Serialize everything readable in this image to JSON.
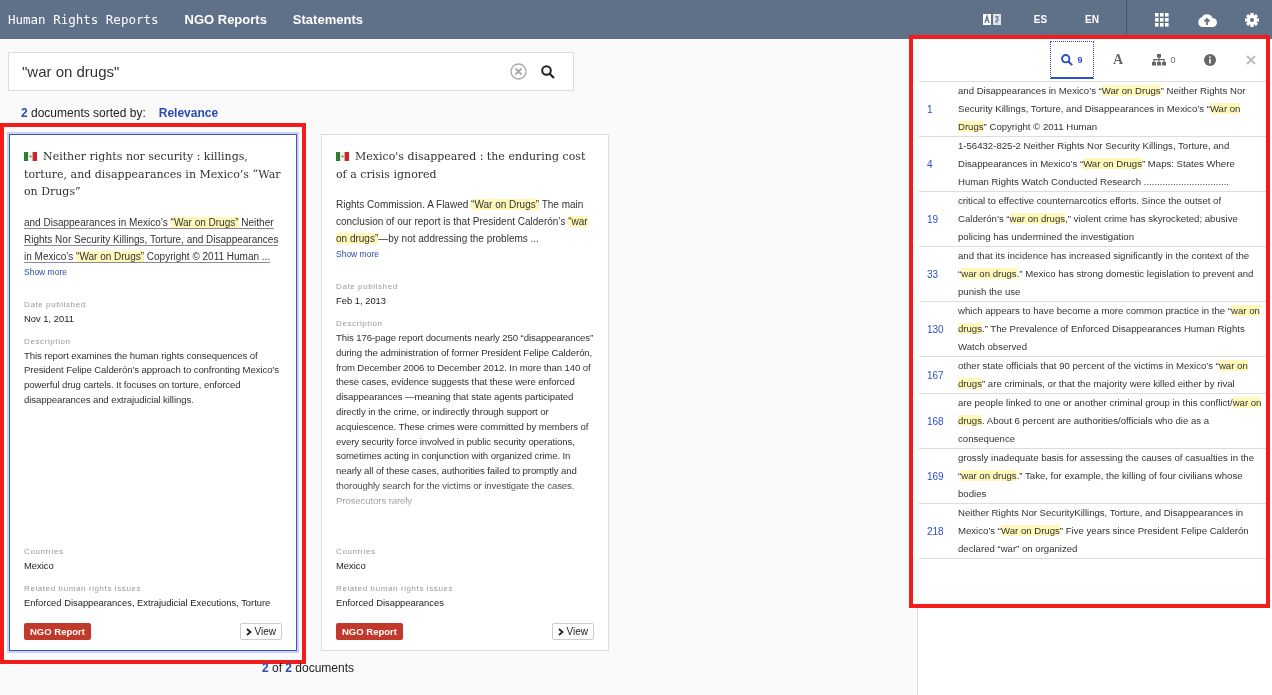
{
  "nav": {
    "brand": "Human Rights Reports",
    "links": [
      "NGO Reports",
      "Statements"
    ],
    "languages": [
      {
        "label": "ES",
        "selected": false
      },
      {
        "label": "EN",
        "selected": false
      }
    ]
  },
  "search": {
    "value": "\"war on drugs\""
  },
  "summary": {
    "count": "2",
    "text": "documents sorted by:",
    "sort": "Relevance"
  },
  "cards": [
    {
      "selected": true,
      "title": "Neither rights nor security : killings, torture, and disappearances in Mexico’s “War on Drugs”",
      "snippet": [
        {
          "text": "and Disappearances in Mexico’s ",
          "highlighted": false
        },
        {
          "text": "“War on Drugs”",
          "highlighted": true
        },
        {
          "text": "  Neither Rights Nor Security Killings, Torture, and Disappearances in Mexico’s ",
          "highlighted": false
        },
        {
          "text": "“War on Drugs”",
          "highlighted": true
        },
        {
          "text": " Copyright © 2011 Human ...",
          "highlighted": false
        }
      ],
      "show_more": "Show more",
      "date_label": "Date published",
      "date": "Nov 1, 2011",
      "description_label": "Description",
      "description": "This report examines the human rights consequences of President Felipe Calderón’s approach to confronting Mexico’s powerful drug cartels. It focuses on torture, enforced disappearances and extrajudicial killings.",
      "faded": false,
      "countries_label": "Countries",
      "countries": "Mexico",
      "issues_label": "Related human rights issues",
      "issues": "Enforced Disappearances, Extrajudicial Executions, Torture",
      "badge": "NGO Report",
      "view": "View"
    },
    {
      "selected": false,
      "title": "Mexico's disappeared : the enduring cost of a crisis ignored",
      "snippet": [
        {
          "text": "Rights Commission. A Flawed ",
          "highlighted": false
        },
        {
          "text": "“War on Drugs”",
          "highlighted": true
        },
        {
          "text": " The main conclusion of our report is that President Calderón’s ",
          "highlighted": false
        },
        {
          "text": "“war on drugs”",
          "highlighted": true
        },
        {
          "text": "—by not addressing the problems ...",
          "highlighted": false
        }
      ],
      "show_more": "Show more",
      "date_label": "Date published",
      "date": "Feb 1, 2013",
      "description_label": "Description",
      "description": "This 176-page report documents nearly 250 “disappearances” during the administration of former President Felipe Calderón, from December 2006 to December 2012. In more than 140 of these cases, evidence suggests that these were enforced disappearances —meaning that state agents participated directly in the crime, or indirectly through support or acquiescence. These crimes were committed by members of every security force involved in public security operations, sometimes acting in conjunction with organized crime. In nearly all of these cases, authorities failed to promptly and thoroughly search for the victims or investigate the cases. Prosecutors rarely",
      "faded": true,
      "countries_label": "Countries",
      "countries": "Mexico",
      "issues_label": "Related human rights issues",
      "issues": "Enforced Disappearances",
      "badge": "NGO Report",
      "view": "View"
    }
  ],
  "pager": {
    "shown": "2",
    "of": "of",
    "total": "2",
    "text": "documents"
  },
  "panel": {
    "tabs": [
      {
        "kind": "search",
        "count": "9",
        "selected": true
      },
      {
        "kind": "font",
        "label": "A",
        "selected": false
      },
      {
        "kind": "structure",
        "count": "0",
        "selected": false
      },
      {
        "kind": "info",
        "selected": false
      }
    ],
    "results": [
      {
        "page": "1",
        "parts": [
          {
            "text": "and Disappearances in Mexico’s “",
            "highlighted": false
          },
          {
            "text": "War on Drugs",
            "highlighted": true
          },
          {
            "text": "”  Neither Rights Nor Security Killings, Torture, and Disappearances in Mexico’s “",
            "highlighted": false
          },
          {
            "text": "War on Drugs",
            "highlighted": true
          },
          {
            "text": "” Copyright © 2011 Human",
            "highlighted": false
          }
        ]
      },
      {
        "page": "4",
        "parts": [
          {
            "text": "1-56432-825-2 Neither Rights Nor Security Killings, Torture, and Disappearances in Mexico’s “",
            "highlighted": false
          },
          {
            "text": "War on Drugs",
            "highlighted": true
          },
          {
            "text": "” Maps: States Where Human Rights Watch Conducted Research ................................",
            "highlighted": false
          }
        ]
      },
      {
        "page": "19",
        "parts": [
          {
            "text": "critical to effective counternarcotics efforts. Since the outset of Calderón’s “",
            "highlighted": false
          },
          {
            "text": "war on drugs",
            "highlighted": true
          },
          {
            "text": ",” violent crime has skyrocketed; abusive policing has undermined the investigation",
            "highlighted": false
          }
        ]
      },
      {
        "page": "33",
        "parts": [
          {
            "text": "and that its incidence has increased significantly in the context of the “",
            "highlighted": false
          },
          {
            "text": "war on drugs",
            "highlighted": true
          },
          {
            "text": ".” Mexico has strong domestic legislation to prevent and punish the use",
            "highlighted": false
          }
        ]
      },
      {
        "page": "130",
        "parts": [
          {
            "text": "which appears to have become a more common practice in the “",
            "highlighted": false
          },
          {
            "text": "war on drugs",
            "highlighted": true
          },
          {
            "text": ".” The Prevalence of Enforced Disappearances Human Rights Watch observed",
            "highlighted": false
          }
        ]
      },
      {
        "page": "167",
        "parts": [
          {
            "text": "other state officials that 90 percent of the victims in Mexico’s “",
            "highlighted": false
          },
          {
            "text": "war on drugs",
            "highlighted": true
          },
          {
            "text": "” are criminals, or that the majority were killed either by rival",
            "highlighted": false
          }
        ]
      },
      {
        "page": "168",
        "parts": [
          {
            "text": "are people linked to one or another criminal group in this conflict/",
            "highlighted": false
          },
          {
            "text": "war on drugs",
            "highlighted": true
          },
          {
            "text": ". About 6 percent are authorities/officials who die as a consequence",
            "highlighted": false
          }
        ]
      },
      {
        "page": "169",
        "parts": [
          {
            "text": "grossly inadequate basis for assessing the causes of casualties in the “",
            "highlighted": false
          },
          {
            "text": "war on drugs",
            "highlighted": true
          },
          {
            "text": ".” Take, for example, the killing of four civilians whose bodies",
            "highlighted": false
          }
        ]
      },
      {
        "page": "218",
        "parts": [
          {
            "text": "Neither Rights Nor SecurityKillings, Torture, and Disappearances in Mexico’s “",
            "highlighted": false
          },
          {
            "text": "War on Drugs",
            "highlighted": true
          },
          {
            "text": "” Five years since President Felipe Calderón declared “war” on organized",
            "highlighted": false
          }
        ]
      }
    ]
  }
}
